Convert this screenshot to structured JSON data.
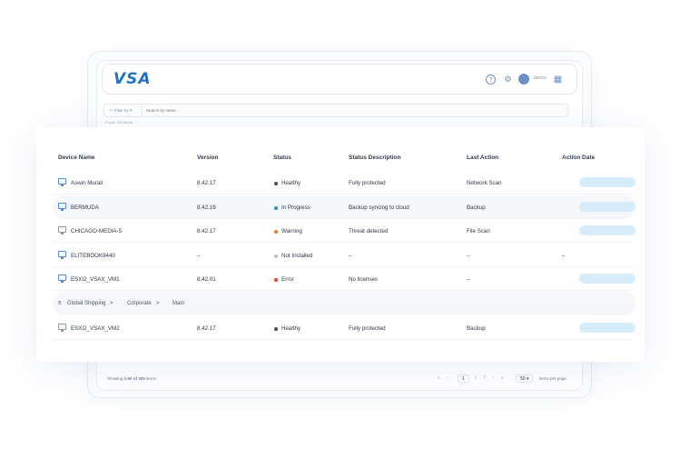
{
  "app": {
    "logo": "VSA",
    "user_name": "James",
    "icons": [
      "help-icon",
      "gear-icon",
      "avatar",
      "grid-icon"
    ]
  },
  "search": {
    "filter_label": "Filter by",
    "placeholder": "Search by name",
    "found_label": "Found 305 items"
  },
  "table": {
    "columns": [
      "Device Name",
      "Version",
      "Status",
      "Status Description",
      "Last Action",
      "Action Date"
    ],
    "rows": [
      {
        "name": "Aswin Murali",
        "version": "8.42.17",
        "status": "Healthy",
        "status_color": "#4a5366",
        "description": "Fully protected",
        "last_action": "Network Scan",
        "date": ""
      },
      {
        "name": "BERMUDA",
        "version": "8.42.16",
        "status": "In Progress",
        "status_color": "#2d8fe0",
        "description": "Backup syncing to cloud",
        "last_action": "Backup",
        "date": ""
      },
      {
        "name": "CHICAGO-MEDIA-5",
        "version": "8.42.17",
        "status": "Warning",
        "status_color": "#f07b2a",
        "description": "Threat detected",
        "last_action": "File Scan",
        "date": ""
      },
      {
        "name": "ELITEBOOK8440",
        "version": "–",
        "status": "Not Installed",
        "status_color": "#b7bfcc",
        "description": "–",
        "last_action": "–",
        "date": "–"
      },
      {
        "name": "ESXI2_VSAX_VM1",
        "version": "8.42.01",
        "status": "Error",
        "status_color": "#e8482f",
        "description": "No licenses",
        "last_action": "–",
        "date": ""
      },
      {
        "name": "ESXI2_VSAX_VM2",
        "version": "8.42.17",
        "status": "Healthy",
        "status_color": "#4a5366",
        "description": "Fully protected",
        "last_action": "Backup",
        "date": ""
      }
    ],
    "breadcrumb": [
      "Global Shipping",
      "Corporate",
      "Main"
    ]
  },
  "footer": {
    "showing_prefix": "Showing",
    "showing_range": "1-50 of 305",
    "showing_suffix": "items",
    "first": "«",
    "prev": "‹",
    "page": "1",
    "of": "/",
    "total_pages": "7",
    "next": "›",
    "last": "»",
    "per_page_value": "50",
    "per_page_label": "items per page"
  },
  "colors": {
    "accent": "#1f73c5",
    "pill": "#d7ecfb"
  }
}
